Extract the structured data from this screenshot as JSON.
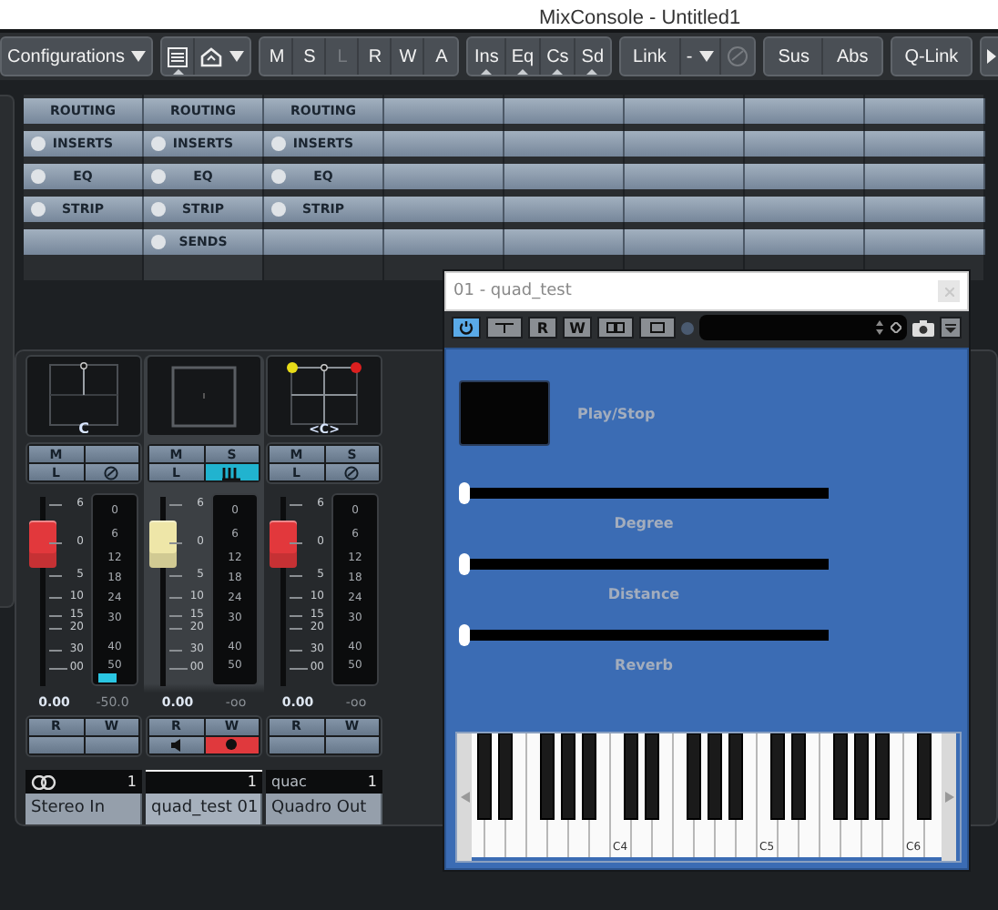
{
  "window": {
    "title": "MixConsole - Untitled1"
  },
  "toolbar": [
    [
      {
        "kind": "dropdown",
        "label": "Configurations"
      }
    ],
    [
      {
        "kind": "list-toggle"
      },
      {
        "kind": "view-menu"
      }
    ],
    [
      {
        "kind": "text",
        "label": "M",
        "disabled": false
      },
      {
        "kind": "text",
        "label": "S",
        "disabled": false
      },
      {
        "kind": "text",
        "label": "L",
        "disabled": true
      },
      {
        "kind": "text",
        "label": "R",
        "disabled": false
      },
      {
        "kind": "text",
        "label": "W",
        "disabled": false
      },
      {
        "kind": "text",
        "label": "A",
        "disabled": false
      }
    ],
    [
      {
        "kind": "tab",
        "label": "Ins"
      },
      {
        "kind": "tab",
        "label": "Eq"
      },
      {
        "kind": "tab",
        "label": "Cs"
      },
      {
        "kind": "tab",
        "label": "Sd"
      }
    ],
    [
      {
        "kind": "text",
        "label": "Link",
        "disabled": false
      },
      {
        "kind": "dropdown",
        "label": "-"
      },
      {
        "kind": "edit-icon",
        "disabled": true
      }
    ],
    [
      {
        "kind": "text",
        "label": "Sus",
        "disabled": false
      },
      {
        "kind": "text",
        "label": "Abs",
        "disabled": false
      }
    ],
    [
      {
        "kind": "text",
        "label": "Q-Link",
        "disabled": false
      }
    ],
    [
      {
        "kind": "expand"
      }
    ]
  ],
  "rack": [
    {
      "cells": [
        {
          "label": "ROUTING",
          "led": false
        },
        {
          "label": "ROUTING",
          "led": false
        },
        {
          "label": "ROUTING",
          "led": false
        }
      ]
    },
    {
      "cells": [
        {
          "label": "INSERTS",
          "led": true
        },
        {
          "label": "INSERTS",
          "led": true
        },
        {
          "label": "INSERTS",
          "led": true
        }
      ]
    },
    {
      "cells": [
        {
          "label": "EQ",
          "led": true
        },
        {
          "label": "EQ",
          "led": true
        },
        {
          "label": "EQ",
          "led": true
        }
      ]
    },
    {
      "cells": [
        {
          "label": "STRIP",
          "led": true
        },
        {
          "label": "STRIP",
          "led": true
        },
        {
          "label": "STRIP",
          "led": true
        }
      ]
    },
    {
      "cells": [
        null,
        {
          "label": "SENDS",
          "led": true
        }
      ]
    }
  ],
  "channels": [
    {
      "selected": false,
      "panner": {
        "kind": "stereo",
        "label": "C"
      },
      "buttons": [
        {
          "kind": "text",
          "label": "M",
          "on": false
        },
        {
          "kind": "blank",
          "on": false
        },
        {
          "kind": "text",
          "label": "L",
          "on": false
        },
        {
          "kind": "edit-icon",
          "on": false
        }
      ],
      "fader": {
        "color": "#e2383c",
        "level": 0.76
      },
      "fader_scale": [
        "6",
        "0",
        "5",
        "10",
        "15",
        "20",
        "30",
        "00"
      ],
      "meter_scale": [
        "0",
        "6",
        "12",
        "18",
        "24",
        "30",
        "40",
        "50"
      ],
      "meter": {
        "level": 0.05
      },
      "volume": "0.00",
      "peak": "-50.0",
      "automation": [
        {
          "kind": "text",
          "label": "R",
          "on": false
        },
        {
          "kind": "text",
          "label": "W",
          "on": false
        },
        {
          "kind": "blank",
          "on": false
        },
        {
          "kind": "blank",
          "on": false
        }
      ],
      "tag": {
        "kind": "link-icon",
        "number": "1"
      },
      "name": "Stereo In"
    },
    {
      "selected": true,
      "panner": {
        "kind": "off"
      },
      "buttons": [
        {
          "kind": "text",
          "label": "M",
          "on": false
        },
        {
          "kind": "text",
          "label": "S",
          "on": false
        },
        {
          "kind": "text",
          "label": "L",
          "on": false
        },
        {
          "kind": "bars-icon",
          "on": true
        }
      ],
      "fader": {
        "color": "#eee6a8",
        "level": 0.76
      },
      "fader_scale": [
        "6",
        "0",
        "5",
        "10",
        "15",
        "20",
        "30",
        "00"
      ],
      "meter_scale": [
        "0",
        "6",
        "12",
        "18",
        "24",
        "30",
        "40",
        "50"
      ],
      "volume": "0.00",
      "peak": "-oo",
      "automation": [
        {
          "kind": "text",
          "label": "R",
          "on": false
        },
        {
          "kind": "text",
          "label": "W",
          "on": false
        },
        {
          "kind": "speaker-icon",
          "on": false
        },
        {
          "kind": "record-icon",
          "on": true
        }
      ],
      "tag": {
        "kind": "none",
        "number": "1"
      },
      "name": "quad_test 01"
    },
    {
      "selected": false,
      "panner": {
        "kind": "surround",
        "label": "<C>"
      },
      "buttons": [
        {
          "kind": "text",
          "label": "M",
          "on": false
        },
        {
          "kind": "text",
          "label": "S",
          "on": false
        },
        {
          "kind": "text",
          "label": "L",
          "on": false
        },
        {
          "kind": "edit-icon",
          "on": false
        }
      ],
      "fader": {
        "color": "#e2383c",
        "level": 0.76
      },
      "fader_scale": [
        "6",
        "0",
        "5",
        "10",
        "15",
        "20",
        "30",
        "00"
      ],
      "meter_scale": [
        "0",
        "6",
        "12",
        "18",
        "24",
        "30",
        "40",
        "50"
      ],
      "volume": "0.00",
      "peak": "-oo",
      "automation": [
        {
          "kind": "text",
          "label": "R",
          "on": false
        },
        {
          "kind": "text",
          "label": "W",
          "on": false
        },
        {
          "kind": "blank",
          "on": false
        },
        {
          "kind": "blank",
          "on": false
        }
      ],
      "tag": {
        "kind": "text",
        "text": "quac",
        "number": "1"
      },
      "name": "Quadro Out"
    }
  ],
  "plugin": {
    "title": "01 - quad_test",
    "power_on": true,
    "toolbar_labels": [
      "R",
      "W"
    ],
    "controls": [
      {
        "kind": "button",
        "label": "Play/Stop"
      },
      {
        "kind": "slider",
        "label": "Degree",
        "level": 0
      },
      {
        "kind": "slider",
        "label": "Distance",
        "level": 0
      },
      {
        "kind": "slider",
        "label": "Reverb",
        "level": 0
      }
    ],
    "keyboard": {
      "labels": [
        "C4",
        "C5",
        "C6"
      ]
    }
  }
}
